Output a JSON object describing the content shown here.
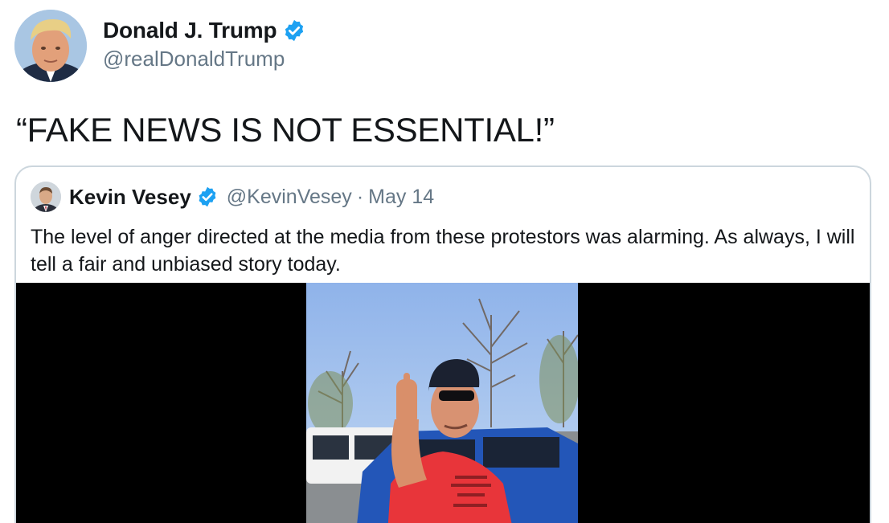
{
  "author": {
    "name": "Donald J. Trump",
    "handle": "@realDonaldTrump",
    "verified": true,
    "avatar_icon": "profile-photo"
  },
  "tweet": {
    "text": "“FAKE NEWS IS NOT ESSENTIAL!”"
  },
  "quoted_tweet": {
    "name": "Kevin Vesey",
    "handle": "@KevinVesey",
    "separator": "·",
    "date": "May 14",
    "verified": true,
    "text": "The level of anger directed at the media from these protestors was alarming. As always, I will tell a fair and unbiased story today.",
    "media": {
      "type": "video",
      "scene": "outdoor-parking-lot-man-red-shirt"
    }
  },
  "colors": {
    "text_primary": "#14171a",
    "text_secondary": "#657786",
    "verified_blue": "#1da1f2",
    "border": "#ccd6dd",
    "media_background": "#000000"
  }
}
